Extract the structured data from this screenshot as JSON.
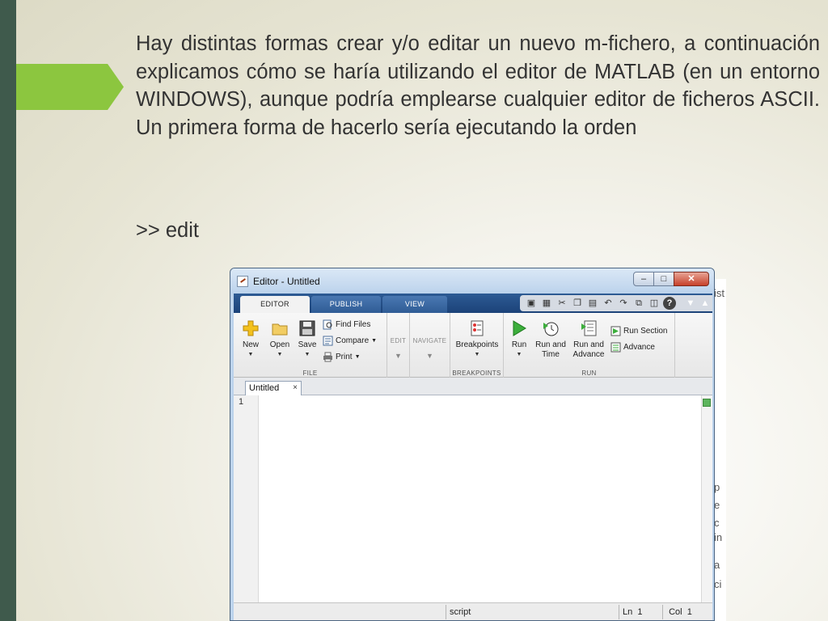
{
  "slide": {
    "paragraph": "Hay distintas formas crear y/o editar un nuevo m-fichero, a continuación explicamos cómo se haría utilizando el editor de MATLAB (en un entorno WINDOWS), aunque podría emplearse cualquier editor de ficheros ASCII. Un primera forma de hacerlo sería ejecutando la orden",
    "command": ">> edit"
  },
  "window": {
    "title": "Editor - Untitled",
    "minimize_label": "–",
    "maximize_label": "□",
    "close_label": "✕"
  },
  "tabs": [
    {
      "label": "EDITOR",
      "active": true
    },
    {
      "label": "PUBLISH",
      "active": false
    },
    {
      "label": "VIEW",
      "active": false
    }
  ],
  "ribbon": {
    "file": {
      "group_label": "FILE",
      "new_label": "New",
      "open_label": "Open",
      "save_label": "Save",
      "find_files_label": "Find Files",
      "compare_label": "Compare",
      "print_label": "Print"
    },
    "edit_label": "EDIT",
    "navigate_label": "NAVIGATE",
    "breakpoints": {
      "group_label": "BREAKPOINTS",
      "button_label": "Breakpoints"
    },
    "run": {
      "group_label": "RUN",
      "run_label": "Run",
      "run_and_time_label": "Run and Time",
      "run_and_advance_label": "Run and Advance",
      "run_section_label": "Run Section",
      "advance_label": "Advance"
    }
  },
  "document": {
    "tab_label": "Untitled",
    "tab_close": "×",
    "line_number": "1"
  },
  "statusbar": {
    "mode": "script",
    "ln_label": "Ln",
    "ln_value": "1",
    "col_label": "Col",
    "col_value": "1"
  },
  "background_window": {
    "fragments": [
      "ist",
      "p",
      "e",
      "c",
      "in",
      "a",
      "ci"
    ]
  },
  "colors": {
    "left_bar": "#3f5a4c",
    "accent_arrow": "#8cc63f",
    "ribbon_tabbar": "#1c4379"
  }
}
